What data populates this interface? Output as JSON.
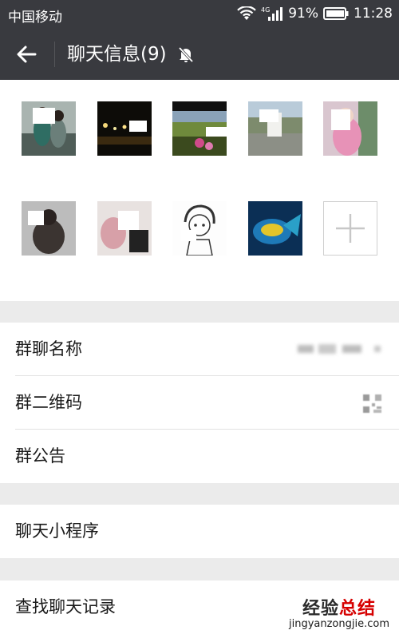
{
  "status_bar": {
    "carrier": "中国移动",
    "network": "4G",
    "battery": "91%",
    "time": "11:28"
  },
  "header": {
    "title": "聊天信息(9)",
    "back_icon": "back-arrow-icon",
    "mute_icon": "bell-off-icon"
  },
  "members": {
    "names": [
      "",
      "",
      "",
      "",
      "",
      "",
      "",
      "",
      ""
    ],
    "add_icon": "plus-icon"
  },
  "settings": {
    "group_name_label": "群聊名称",
    "qr_label": "群二维码",
    "notice_label": "群公告",
    "mini_program_label": "聊天小程序",
    "search_history_label": "查找聊天记录"
  },
  "watermark": {
    "text_a": "经验",
    "text_b": "总结",
    "url": "jingyanzongjie.com"
  },
  "colors": {
    "title_bar": "#393a3f",
    "page_bg": "#ebebeb",
    "accent_red": "#d60000"
  }
}
